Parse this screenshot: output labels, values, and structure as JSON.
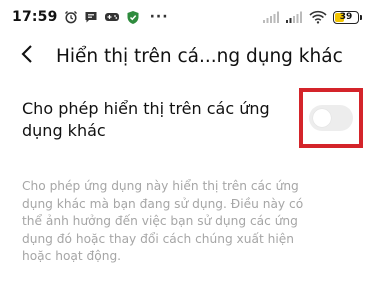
{
  "status_bar": {
    "time": "17:59",
    "icons": [
      "alarm-icon",
      "message-icon",
      "game-controller-icon",
      "shield-icon"
    ],
    "more": "···",
    "battery_level": "39",
    "battery_fraction": 0.39,
    "accent_battery": "#f2c400"
  },
  "header": {
    "back_icon": "chevron-left-icon",
    "title": "Hiển thị trên cá...ng dụng khác"
  },
  "setting": {
    "label": "Cho phép hiển thị trên các ứng dụng khác",
    "toggle_state": "off",
    "highlight_color": "#d4242a"
  },
  "description": "Cho phép ứng dụng này hiển thị trên các ứng dụng khác mà bạn đang sử dụng. Điều này có thể ảnh hưởng đến việc bạn sử dụng các ứng dụng đó hoặc thay đổi cách chúng xuất hiện hoặc hoạt động."
}
